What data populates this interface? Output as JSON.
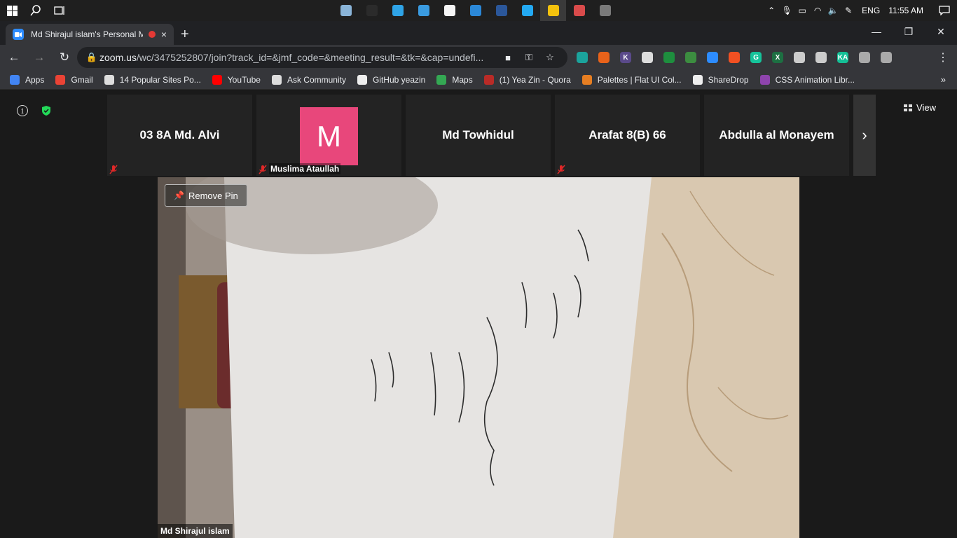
{
  "taskbar": {
    "apps": [
      {
        "icon": "photos-icon",
        "color": "#8ab4d8"
      },
      {
        "icon": "terminal-icon",
        "color": "#2b2b2b"
      },
      {
        "icon": "edge-icon",
        "color": "#2fa4e7"
      },
      {
        "icon": "pc-icon",
        "color": "#3a9be0"
      },
      {
        "icon": "store-icon",
        "color": "#f5f5f5"
      },
      {
        "icon": "mail-icon",
        "color": "#2b88d8"
      },
      {
        "icon": "word-icon",
        "color": "#2b579a"
      },
      {
        "icon": "vscode-icon",
        "color": "#23a9f2"
      },
      {
        "icon": "chrome-icon",
        "color": "#f4c20d"
      },
      {
        "icon": "snip-icon",
        "color": "#d94b4b"
      },
      {
        "icon": "calculator-icon",
        "color": "#7a7a7a"
      }
    ],
    "language": "ENG",
    "time": "11:55 AM"
  },
  "browser": {
    "tab_title": "Md Shirajul islam's Personal M",
    "tab_close": "×",
    "new_tab": "+",
    "url_host": "zoom.us",
    "url_path": "/wc/3475252807/join?track_id=&jmf_code=&meeting_result=&tk=&cap=undefi...",
    "extensions": [
      {
        "icon": "ext-1-icon",
        "color": "#1ba39c",
        "label": ""
      },
      {
        "icon": "ext-2-icon",
        "color": "#e8621a",
        "label": ""
      },
      {
        "icon": "ext-3-icon",
        "color": "#5a4a8a",
        "label": "K"
      },
      {
        "icon": "ext-4-icon",
        "color": "#dddddd",
        "label": ""
      },
      {
        "icon": "ext-5-icon",
        "color": "#1e8e3e",
        "label": ""
      },
      {
        "icon": "ext-6-icon",
        "color": "#3c8d40",
        "label": ""
      },
      {
        "icon": "ext-7-icon",
        "color": "#2d8cff",
        "label": ""
      },
      {
        "icon": "ext-8-icon",
        "color": "#f25022",
        "label": ""
      },
      {
        "icon": "ext-9-icon",
        "color": "#15c39a",
        "label": "G"
      },
      {
        "icon": "ext-10-icon",
        "color": "#1d6f42",
        "label": "X"
      },
      {
        "icon": "ext-11-icon",
        "color": "#cccccc",
        "label": ""
      },
      {
        "icon": "ext-12-icon",
        "color": "#cccccc",
        "label": ""
      },
      {
        "icon": "ext-13-icon",
        "color": "#14bf96",
        "label": "KA"
      },
      {
        "icon": "ext-14-icon",
        "color": "#aaaaaa",
        "label": ""
      },
      {
        "icon": "ext-15-icon",
        "color": "#aaaaaa",
        "label": ""
      }
    ]
  },
  "bookmarks": [
    {
      "label": "Apps",
      "icon": "apps-grid-icon",
      "color": "#4285f4"
    },
    {
      "label": "Gmail",
      "icon": "gmail-icon",
      "color": "#ea4335"
    },
    {
      "label": "14 Popular Sites Po...",
      "icon": "globe-icon",
      "color": "#dddddd"
    },
    {
      "label": "YouTube",
      "icon": "youtube-icon",
      "color": "#ff0000"
    },
    {
      "label": "Ask Community",
      "icon": "globe-icon",
      "color": "#dddddd"
    },
    {
      "label": "GitHub yeazin",
      "icon": "github-icon",
      "color": "#eeeeee"
    },
    {
      "label": "Maps",
      "icon": "maps-icon",
      "color": "#34a853"
    },
    {
      "label": "(1) Yea Zin - Quora",
      "icon": "quora-icon",
      "color": "#b92b27"
    },
    {
      "label": "Palettes | Flat UI Col...",
      "icon": "palette-icon",
      "color": "#e67e22"
    },
    {
      "label": "ShareDrop",
      "icon": "sharedrop-icon",
      "color": "#eeeeee"
    },
    {
      "label": "CSS Animation Libr...",
      "icon": "css-icon",
      "color": "#8e44ad"
    }
  ],
  "zoom": {
    "view_label": "View",
    "participants": [
      {
        "name": "03 8A Md. Alvi",
        "muted": true,
        "label": ""
      },
      {
        "name": "",
        "avatar_letter": "M",
        "muted": true,
        "label": "Muslima Ataullah"
      },
      {
        "name": "Md Towhidul",
        "muted": false,
        "label": ""
      },
      {
        "name": "Arafat 8(B) 66",
        "muted": true,
        "label": ""
      },
      {
        "name": "Abdulla al Monayem",
        "muted": false,
        "label": ""
      }
    ],
    "remove_pin_label": "Remove Pin",
    "pinned_name": "Md Shirajul islam"
  }
}
